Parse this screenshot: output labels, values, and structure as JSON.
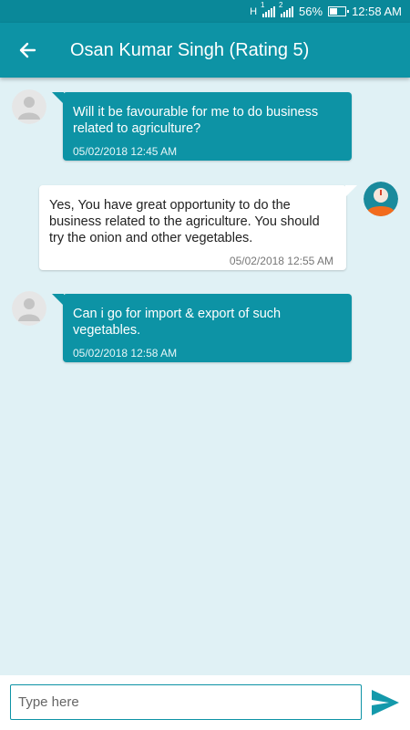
{
  "status_bar": {
    "network_type": "H",
    "sim1": "1",
    "sim2": "2",
    "battery": "56%",
    "battery_level": 0.56,
    "time": "12:58 AM"
  },
  "header": {
    "title": "Osan Kumar Singh (Rating 5)",
    "back_icon": "arrow-left-icon"
  },
  "messages": [
    {
      "direction": "incoming",
      "text": "Will it be favourable for me to do business related to agriculture?",
      "time": "05/02/2018 12:45 AM",
      "avatar": "default-user-avatar"
    },
    {
      "direction": "outgoing",
      "text": "Yes, You have great opportunity to do the business related to the agriculture. You should try the onion and other vegetables.",
      "time": "05/02/2018 12:55 AM",
      "avatar": "astrologer-avatar"
    },
    {
      "direction": "incoming",
      "text": "Can i go for import & export of such vegetables.",
      "time": "05/02/2018 12:58 AM",
      "avatar": "default-user-avatar"
    }
  ],
  "composer": {
    "placeholder": "Type here",
    "value": "",
    "send_icon": "send-icon"
  },
  "colors": {
    "primary": "#0d93a5",
    "status_bar": "#0a8899",
    "chat_background": "#e0f1f5",
    "outgoing_bubble": "#ffffff",
    "avatar_accent": "#f26b1d"
  }
}
